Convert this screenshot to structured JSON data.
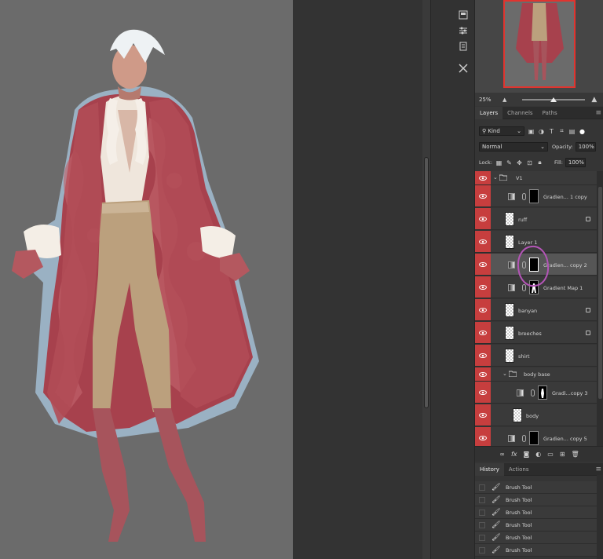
{
  "navigator": {
    "zoom": "25%"
  },
  "layers_panel": {
    "tabs": [
      "Layers",
      "Channels",
      "Paths"
    ],
    "filter_kind": "Kind",
    "blend_mode": "Normal",
    "opacity_label": "Opacity:",
    "opacity_value": "100%",
    "lock_label": "Lock:",
    "fill_label": "Fill:",
    "fill_value": "100%",
    "layers": [
      {
        "name": "V1",
        "kind": "group"
      },
      {
        "name": "Gradien... 1 copy",
        "kind": "adjustment"
      },
      {
        "name": "ruff",
        "kind": "pixel",
        "locked": true
      },
      {
        "name": "Layer 1",
        "kind": "pixel"
      },
      {
        "name": "Gradien... copy 2",
        "kind": "adjustment",
        "selected": true
      },
      {
        "name": "Gradient Map 1",
        "kind": "adjustment"
      },
      {
        "name": "banyan",
        "kind": "pixel",
        "locked": true
      },
      {
        "name": "breeches",
        "kind": "pixel",
        "locked": true
      },
      {
        "name": "shirt",
        "kind": "pixel"
      },
      {
        "name": "body base",
        "kind": "group"
      },
      {
        "name": "Gradi...copy 3",
        "kind": "adjustment"
      },
      {
        "name": "body",
        "kind": "pixel"
      },
      {
        "name": "Gradien... copy 5",
        "kind": "adjustment"
      }
    ],
    "footer_icons": [
      "link-icon",
      "fx-icon",
      "mask-icon",
      "adjustment-icon",
      "folder-icon",
      "new-layer-icon",
      "trash-icon"
    ]
  },
  "history_panel": {
    "tabs": [
      "History",
      "Actions"
    ],
    "items": [
      "Brush Tool",
      "Brush Tool",
      "Brush Tool",
      "Brush Tool",
      "Brush Tool",
      "Brush Tool"
    ]
  },
  "colors": {
    "eye_column": "#c73e3e",
    "annotation": "#b455b7",
    "navigator_frame": "#e0342f"
  }
}
